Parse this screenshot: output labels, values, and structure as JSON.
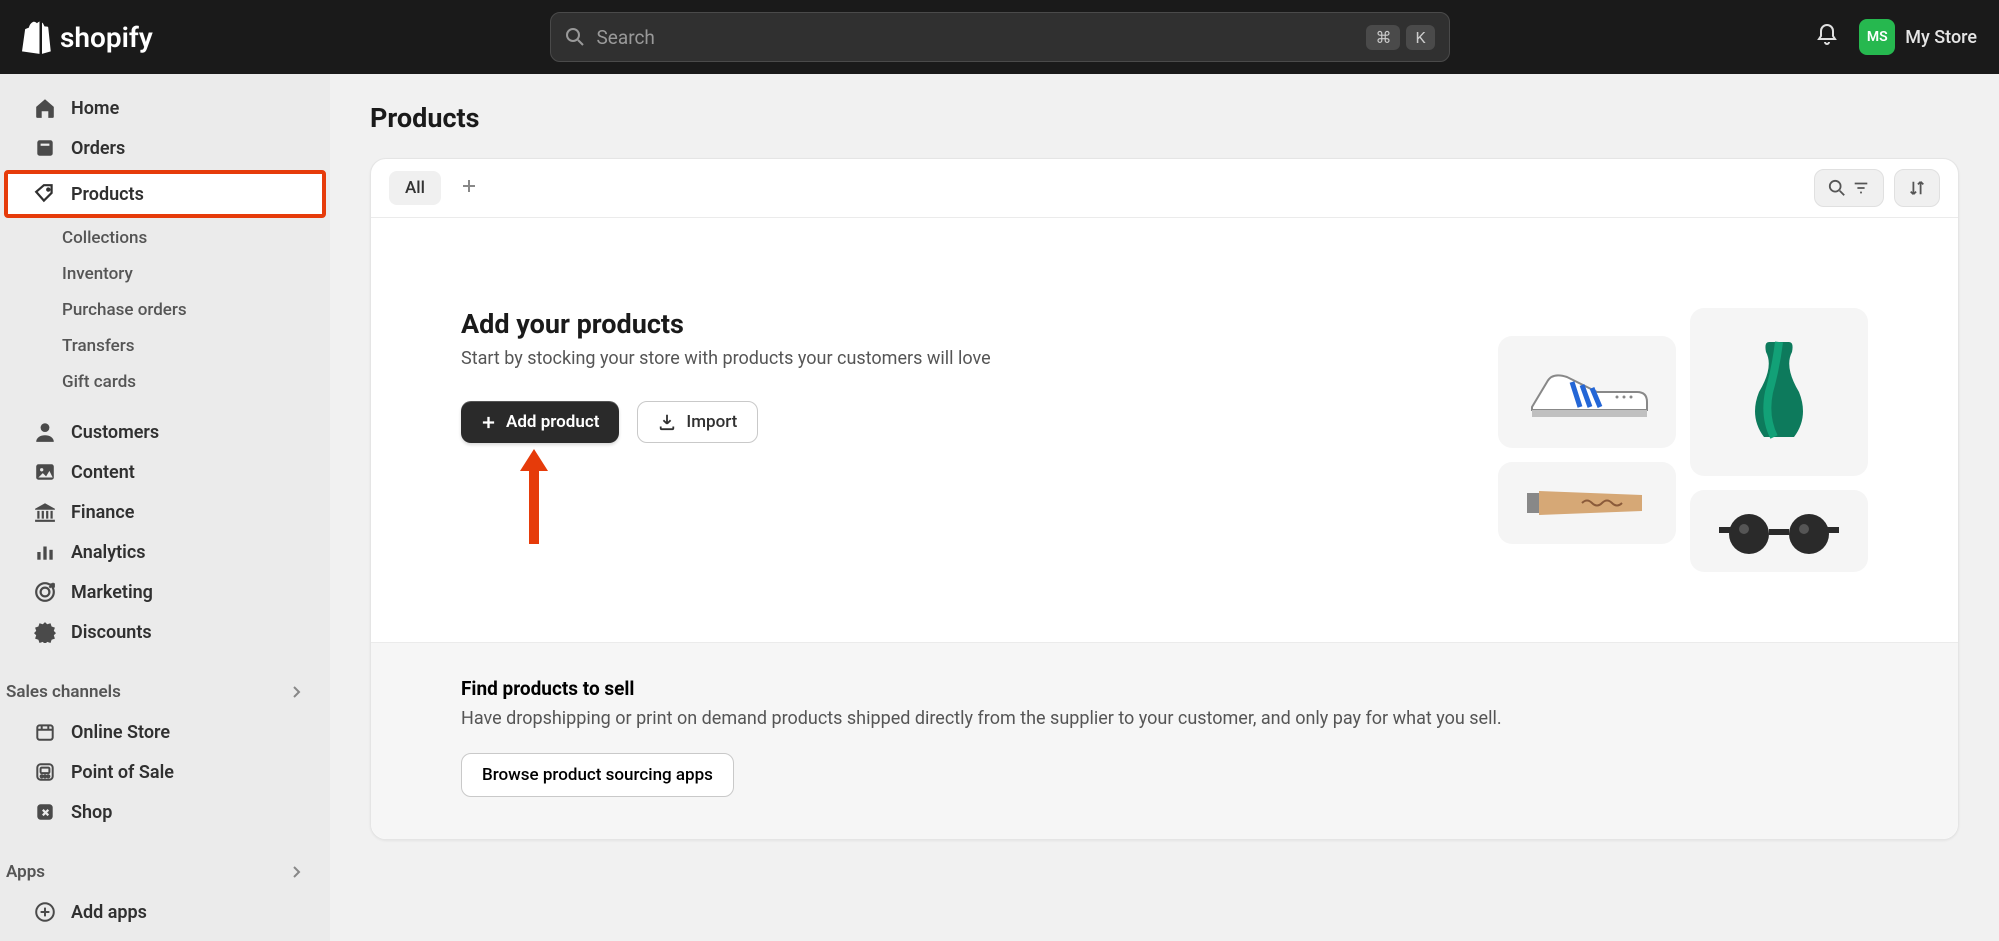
{
  "header": {
    "logo_text": "shopify",
    "search_placeholder": "Search",
    "kbd1": "⌘",
    "kbd2": "K",
    "avatar_initials": "MS",
    "store_name": "My Store"
  },
  "sidebar": {
    "home": "Home",
    "orders": "Orders",
    "products": "Products",
    "collections": "Collections",
    "inventory": "Inventory",
    "purchase_orders": "Purchase orders",
    "transfers": "Transfers",
    "gift_cards": "Gift cards",
    "customers": "Customers",
    "content": "Content",
    "finance": "Finance",
    "analytics": "Analytics",
    "marketing": "Marketing",
    "discounts": "Discounts",
    "sales_channels": "Sales channels",
    "online_store": "Online Store",
    "pos": "Point of Sale",
    "shop": "Shop",
    "apps": "Apps",
    "add_apps": "Add apps"
  },
  "page": {
    "title": "Products",
    "tab_all": "All",
    "empty_heading": "Add your products",
    "empty_sub": "Start by stocking your store with products your customers will love",
    "add_btn": "Add product",
    "import_btn": "Import",
    "footer_heading": "Find products to sell",
    "footer_sub": "Have dropshipping or print on demand products shipped directly from the supplier to your customer, and only pay for what you sell.",
    "browse_btn": "Browse product sourcing apps"
  }
}
